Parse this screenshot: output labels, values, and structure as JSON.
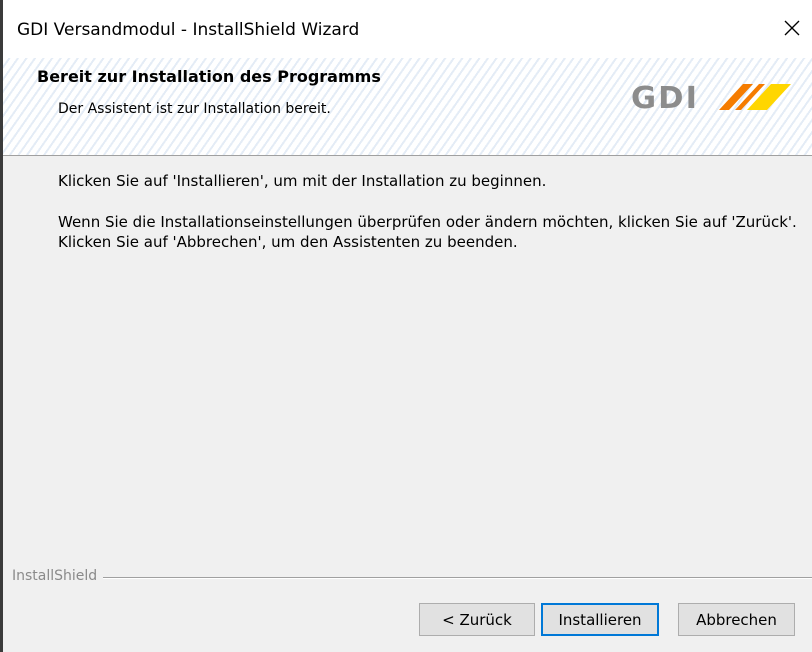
{
  "window": {
    "title": "GDI Versandmodul - InstallShield Wizard",
    "close_icon": "close-icon"
  },
  "header": {
    "title": "Bereit zur Installation des Programms",
    "subtitle": "Der Assistent ist zur Installation bereit.",
    "logo_text": "GDI",
    "logo_colors": [
      "#f57c00",
      "#ffd600"
    ]
  },
  "main": {
    "line1": "Klicken Sie auf 'Installieren', um mit der Installation zu beginnen.",
    "para2": "Wenn Sie die Installationseinstellungen überprüfen oder ändern möchten, klicken Sie auf 'Zurück'. Klicken Sie auf 'Abbrechen', um den Assistenten zu beenden."
  },
  "footer": {
    "brand_label": "InstallShield",
    "back_label": "< Zurück",
    "install_label": "Installieren",
    "cancel_label": "Abbrechen"
  },
  "colors": {
    "accent": "#0078d7",
    "dialog_bg": "#f0f0f0"
  }
}
